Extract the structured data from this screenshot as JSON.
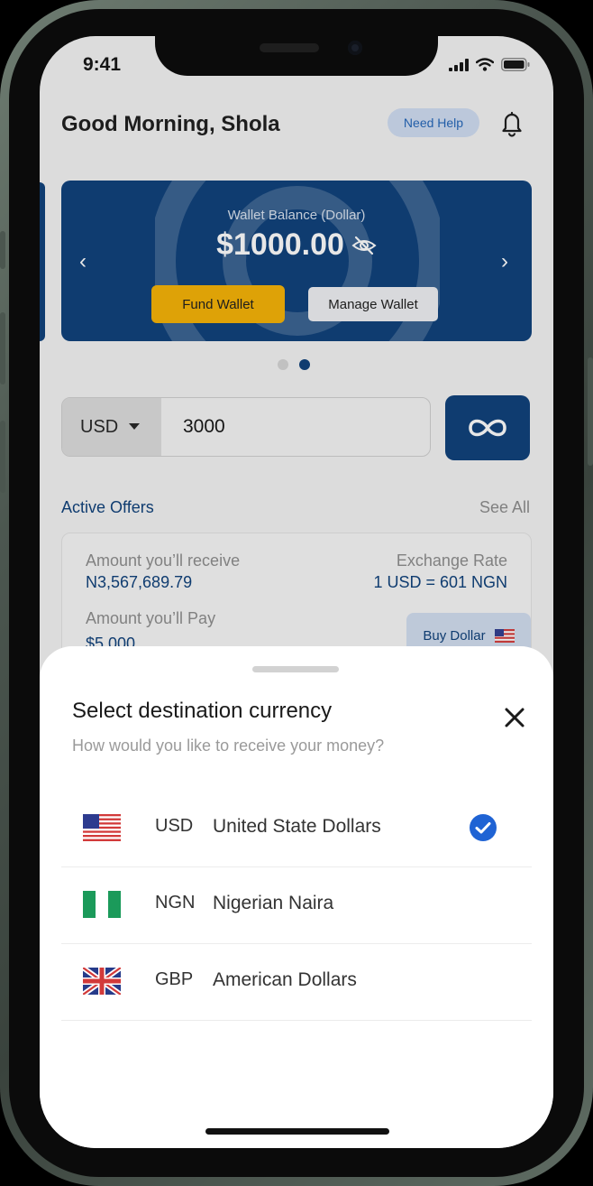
{
  "status_bar": {
    "time": "9:41"
  },
  "header": {
    "greeting": "Good Morning, Shola",
    "help_label": "Need Help"
  },
  "wallet": {
    "label": "Wallet Balance (Dollar)",
    "amount": "$1000.00",
    "fund_label": "Fund Wallet",
    "manage_label": "Manage Wallet",
    "prev_arrow": "‹",
    "next_arrow": "›",
    "active_page": 2,
    "page_count": 2
  },
  "exchange": {
    "currency": "USD",
    "amount": "3000"
  },
  "offers": {
    "title": "Active Offers",
    "see_all": "See All",
    "receive_label": "Amount you’ll receive",
    "receive_value": "N3,567,689.79",
    "rate_label": "Exchange Rate",
    "rate_value": "1 USD = 601 NGN",
    "pay_label": "Amount you’ll Pay",
    "pay_value": "$5,000",
    "buy_label": "Buy Dollar"
  },
  "sheet": {
    "title": "Select destination currency",
    "subtitle": "How would you like to receive your money?",
    "currencies": [
      {
        "code": "USD",
        "name": "United State Dollars",
        "flag": "us-flag-icon",
        "selected": true
      },
      {
        "code": "NGN",
        "name": "Nigerian Naira",
        "flag": "ng-flag-icon",
        "selected": false
      },
      {
        "code": "GBP",
        "name": "American Dollars",
        "flag": "gb-flag-icon",
        "selected": false
      }
    ]
  },
  "colors": {
    "primary": "#0A3D78",
    "accent": "#F5B100",
    "check": "#1F63D4"
  }
}
